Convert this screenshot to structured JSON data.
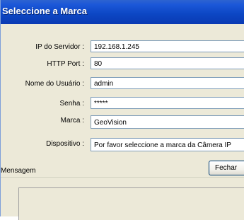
{
  "window": {
    "title": "Seleccione a Marca"
  },
  "form": {
    "server_ip": {
      "label": "IP do Servidor :",
      "value": "192.168.1.245"
    },
    "http_port": {
      "label": "HTTP Port :",
      "value": "80"
    },
    "username": {
      "label": "Nome do Usuário :",
      "value": "admin"
    },
    "password": {
      "label": "Senha :",
      "value": "*****"
    },
    "brand": {
      "label": "Marca :",
      "value": "GeoVision"
    },
    "device": {
      "label": "Dispositivo :",
      "value": "Por favor seleccione a marca da Câmera IP"
    }
  },
  "buttons": {
    "close_label": "Fechar"
  },
  "message": {
    "label": "Mensagem"
  }
}
